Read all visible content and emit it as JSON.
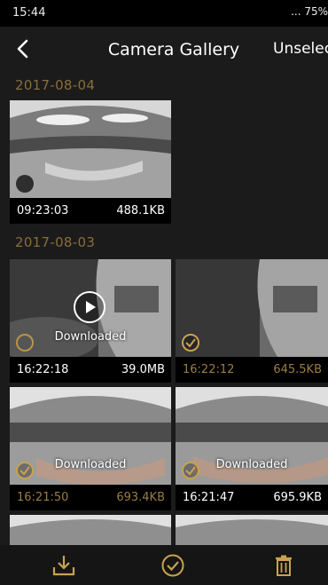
{
  "status_bar": {
    "time": "15:44",
    "right_text": "... 75%"
  },
  "header": {
    "title": "Camera Gallery",
    "unselect_label": "Unselect"
  },
  "groups": [
    {
      "date": "2017-08-04",
      "items": [
        {
          "time": "09:23:03",
          "size": "488.1KB",
          "downloaded": false,
          "selected": false
        }
      ]
    },
    {
      "date": "2017-08-03",
      "items": [
        {
          "time": "16:22:18",
          "size": "39.0MB",
          "downloaded": true,
          "downloaded_label": "Downloaded",
          "selected": false,
          "video": true
        },
        {
          "time": "16:22:12",
          "size": "645.5KB",
          "downloaded": false,
          "selected": true
        },
        {
          "time": "16:21:50",
          "size": "693.4KB",
          "downloaded": true,
          "downloaded_label": "Downloaded",
          "selected": true
        },
        {
          "time": "16:21:47",
          "size": "695.9KB",
          "downloaded": true,
          "downloaded_label": "Downloaded",
          "selected": true
        }
      ]
    }
  ],
  "colors": {
    "accent": "#c9a24f",
    "date_text": "#8a6d3b",
    "background": "#1b1b1b"
  },
  "bottom_bar": {
    "download_icon": "download-icon",
    "select_all_icon": "check-circle-icon",
    "delete_icon": "trash-icon"
  }
}
